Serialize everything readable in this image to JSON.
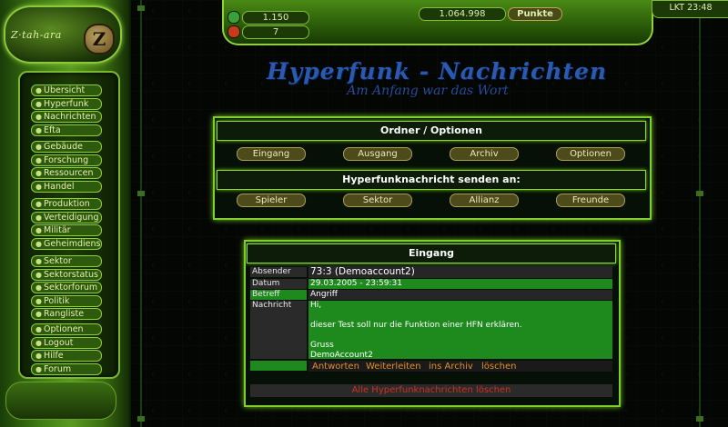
{
  "brand": {
    "logo_text": "Z·tah-ara",
    "logo_letter": "Z"
  },
  "sidebar": {
    "groups": [
      [
        "Übersicht",
        "Hyperfunk",
        "Nachrichten",
        "Efta"
      ],
      [
        "Gebäude",
        "Forschung",
        "Ressourcen",
        "Handel"
      ],
      [
        "Produktion",
        "Verteidigung",
        "Militär",
        "Geheimdienst"
      ],
      [
        "Sektor",
        "Sektorstatus",
        "Sektorforum",
        "Politik",
        "Rangliste"
      ],
      [
        "Optionen",
        "Logout",
        "Hilfe",
        "Forum"
      ]
    ]
  },
  "topbar": {
    "res1": "1.150",
    "res2": "7",
    "points_value": "1.064.998",
    "points_label": "Punkte",
    "time": "LKT 23:48",
    "btn1_color": "#3aa03a",
    "btn2_color": "#c83a1a"
  },
  "page": {
    "title": "Hyperfunk - Nachrichten",
    "subtitle": "Am Anfang war das Wort"
  },
  "folders": {
    "header": "Ordner / Optionen",
    "buttons": [
      "Eingang",
      "Ausgang",
      "Archiv",
      "Optionen"
    ]
  },
  "send_to": {
    "header": "Hyperfunknachricht senden an:",
    "buttons": [
      "Spieler",
      "Sektor",
      "Allianz",
      "Freunde"
    ]
  },
  "inbox": {
    "header": "Eingang",
    "sender_label": "Absender",
    "sender": "73:3 (Demoaccount2)",
    "date_label": "Datum",
    "date": "29.03.2005 - 23:59:31",
    "subject_label": "Betreff",
    "subject": "Angriff",
    "message_label": "Nachricht",
    "message_lines": [
      "Hi,",
      "",
      "dieser Test soll nur die Funktion einer HFN erklären.",
      "",
      "Gruss",
      "DemoAccount2"
    ],
    "actions": [
      "Antworten",
      "Weiterleiten",
      "ins Archiv",
      "löschen"
    ],
    "delete_all": "Alle Hyperfunknachrichten löschen"
  },
  "colors": {
    "accent": "#7fcf30",
    "message_bg": "#1e8a1e",
    "title_blue": "#2a5ab0",
    "delete_red": "#d03020"
  }
}
